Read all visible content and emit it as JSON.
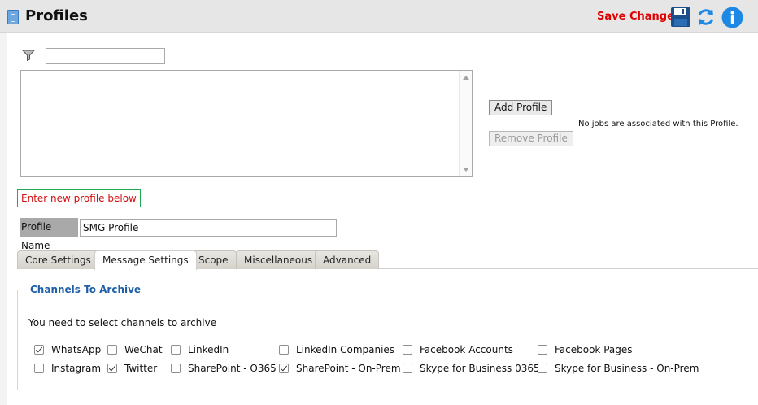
{
  "header": {
    "title": "Profiles",
    "save_label": "Save Changes",
    "icons": [
      "save-icon",
      "refresh-icon",
      "info-icon"
    ]
  },
  "filter": {
    "value": "",
    "placeholder": ""
  },
  "profiles_list": {
    "items": []
  },
  "buttons": {
    "add_profile": "Add Profile",
    "remove_profile": "Remove Profile"
  },
  "status": {
    "no_jobs": "No jobs are associated with this Profile."
  },
  "hint": "Enter new profile below",
  "profile_name": {
    "label": "Profile Name",
    "value": "SMG Profile"
  },
  "tabs": [
    {
      "label": "Core Settings",
      "active": false
    },
    {
      "label": "Message Settings",
      "active": true
    },
    {
      "label": "Scope",
      "active": false
    },
    {
      "label": "Miscellaneous",
      "active": false
    },
    {
      "label": "Advanced",
      "active": false
    }
  ],
  "channels": {
    "legend": "Channels To Archive",
    "instruction": "You need to select channels to archive",
    "items": [
      {
        "label": "WhatsApp",
        "checked": true
      },
      {
        "label": "WeChat",
        "checked": false
      },
      {
        "label": "LinkedIn",
        "checked": false
      },
      {
        "label": "LinkedIn Companies",
        "checked": false
      },
      {
        "label": "Facebook Accounts",
        "checked": false
      },
      {
        "label": "Facebook Pages",
        "checked": false
      },
      {
        "label": "Instagram",
        "checked": false
      },
      {
        "label": "Twitter",
        "checked": true
      },
      {
        "label": "SharePoint - O365",
        "checked": false
      },
      {
        "label": "SharePoint - On-Prem",
        "checked": true
      },
      {
        "label": "Skype for Business 0365",
        "checked": false
      },
      {
        "label": "Skype for Business - On-Prem",
        "checked": false
      }
    ]
  },
  "colors": {
    "save": "#e00000",
    "accent_blue": "#1e88e5",
    "legend": "#1f5fa8",
    "hint_border": "#22aa55",
    "hint_text": "#d01010"
  }
}
